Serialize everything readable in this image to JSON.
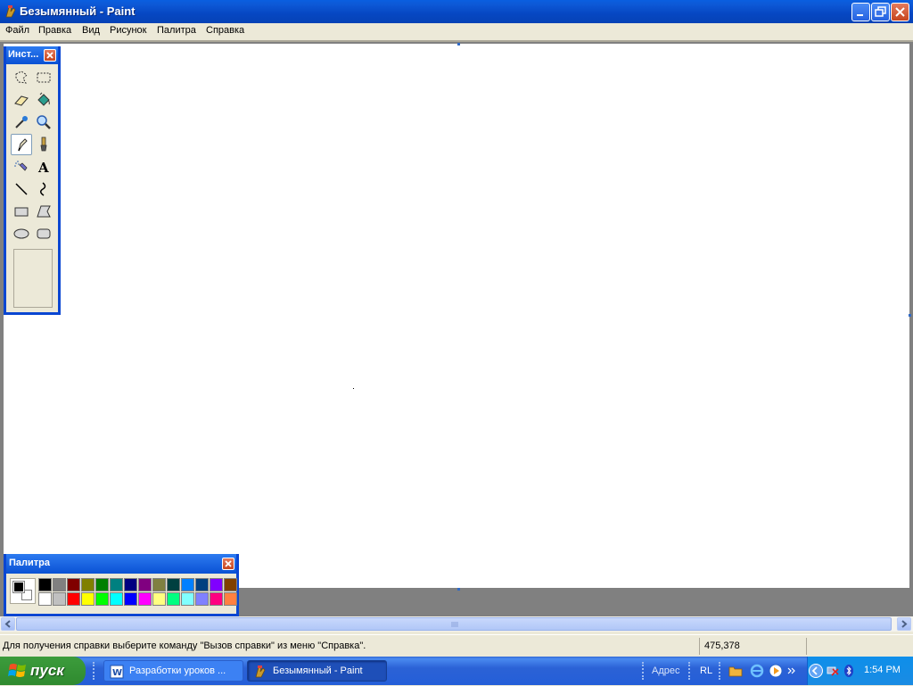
{
  "window": {
    "title": "Безымянный - Paint",
    "icon": "paint-icon",
    "controls": {
      "minimize": "minimize-icon",
      "maximize": "restore-icon",
      "close": "close-icon"
    }
  },
  "menu": {
    "items": [
      "Файл",
      "Правка",
      "Вид",
      "Рисунок",
      "Палитра",
      "Справка"
    ]
  },
  "toolbox": {
    "title": "Инст...",
    "tools": [
      {
        "name": "free-select",
        "icon": "free-form-select-icon"
      },
      {
        "name": "rect-select",
        "icon": "rect-select-icon"
      },
      {
        "name": "eraser",
        "icon": "eraser-icon"
      },
      {
        "name": "fill",
        "icon": "fill-bucket-icon"
      },
      {
        "name": "pick-color",
        "icon": "color-picker-icon"
      },
      {
        "name": "magnifier",
        "icon": "magnifier-icon"
      },
      {
        "name": "pencil",
        "icon": "pencil-icon",
        "selected": true
      },
      {
        "name": "brush",
        "icon": "brush-icon"
      },
      {
        "name": "airbrush",
        "icon": "airbrush-icon"
      },
      {
        "name": "text",
        "icon": "text-icon"
      },
      {
        "name": "line",
        "icon": "line-icon"
      },
      {
        "name": "curve",
        "icon": "curve-icon"
      },
      {
        "name": "rectangle",
        "icon": "rectangle-icon"
      },
      {
        "name": "polygon",
        "icon": "polygon-icon"
      },
      {
        "name": "ellipse",
        "icon": "ellipse-icon"
      },
      {
        "name": "rounded-rect",
        "icon": "rounded-rect-icon"
      }
    ]
  },
  "palette": {
    "title": "Палитра",
    "foreground": "#000000",
    "background": "#FFFFFF",
    "row1": [
      "#000000",
      "#808080",
      "#800000",
      "#808000",
      "#008000",
      "#008080",
      "#000080",
      "#800080",
      "#808040",
      "#004040",
      "#0080FF",
      "#004080",
      "#8000FF",
      "#804000"
    ],
    "row2": [
      "#FFFFFF",
      "#C0C0C0",
      "#FF0000",
      "#FFFF00",
      "#00FF00",
      "#00FFFF",
      "#0000FF",
      "#FF00FF",
      "#FFFF80",
      "#00FF80",
      "#80FFFF",
      "#8080FF",
      "#FF0080",
      "#FF8040"
    ]
  },
  "statusbar": {
    "help_text": "Для получения справки выберите команду \"Вызов справки\" из меню \"Справка\".",
    "coords": "475,378"
  },
  "taskbar": {
    "start_label": "пуск",
    "tasks": [
      {
        "label": "Разработки уроков ...",
        "icon": "word-doc-icon",
        "active": false
      },
      {
        "label": "Безымянный - Paint",
        "icon": "paint-icon",
        "active": true
      }
    ],
    "address_label": "Адрес",
    "language": "RL",
    "clock": "1:54 PM"
  }
}
